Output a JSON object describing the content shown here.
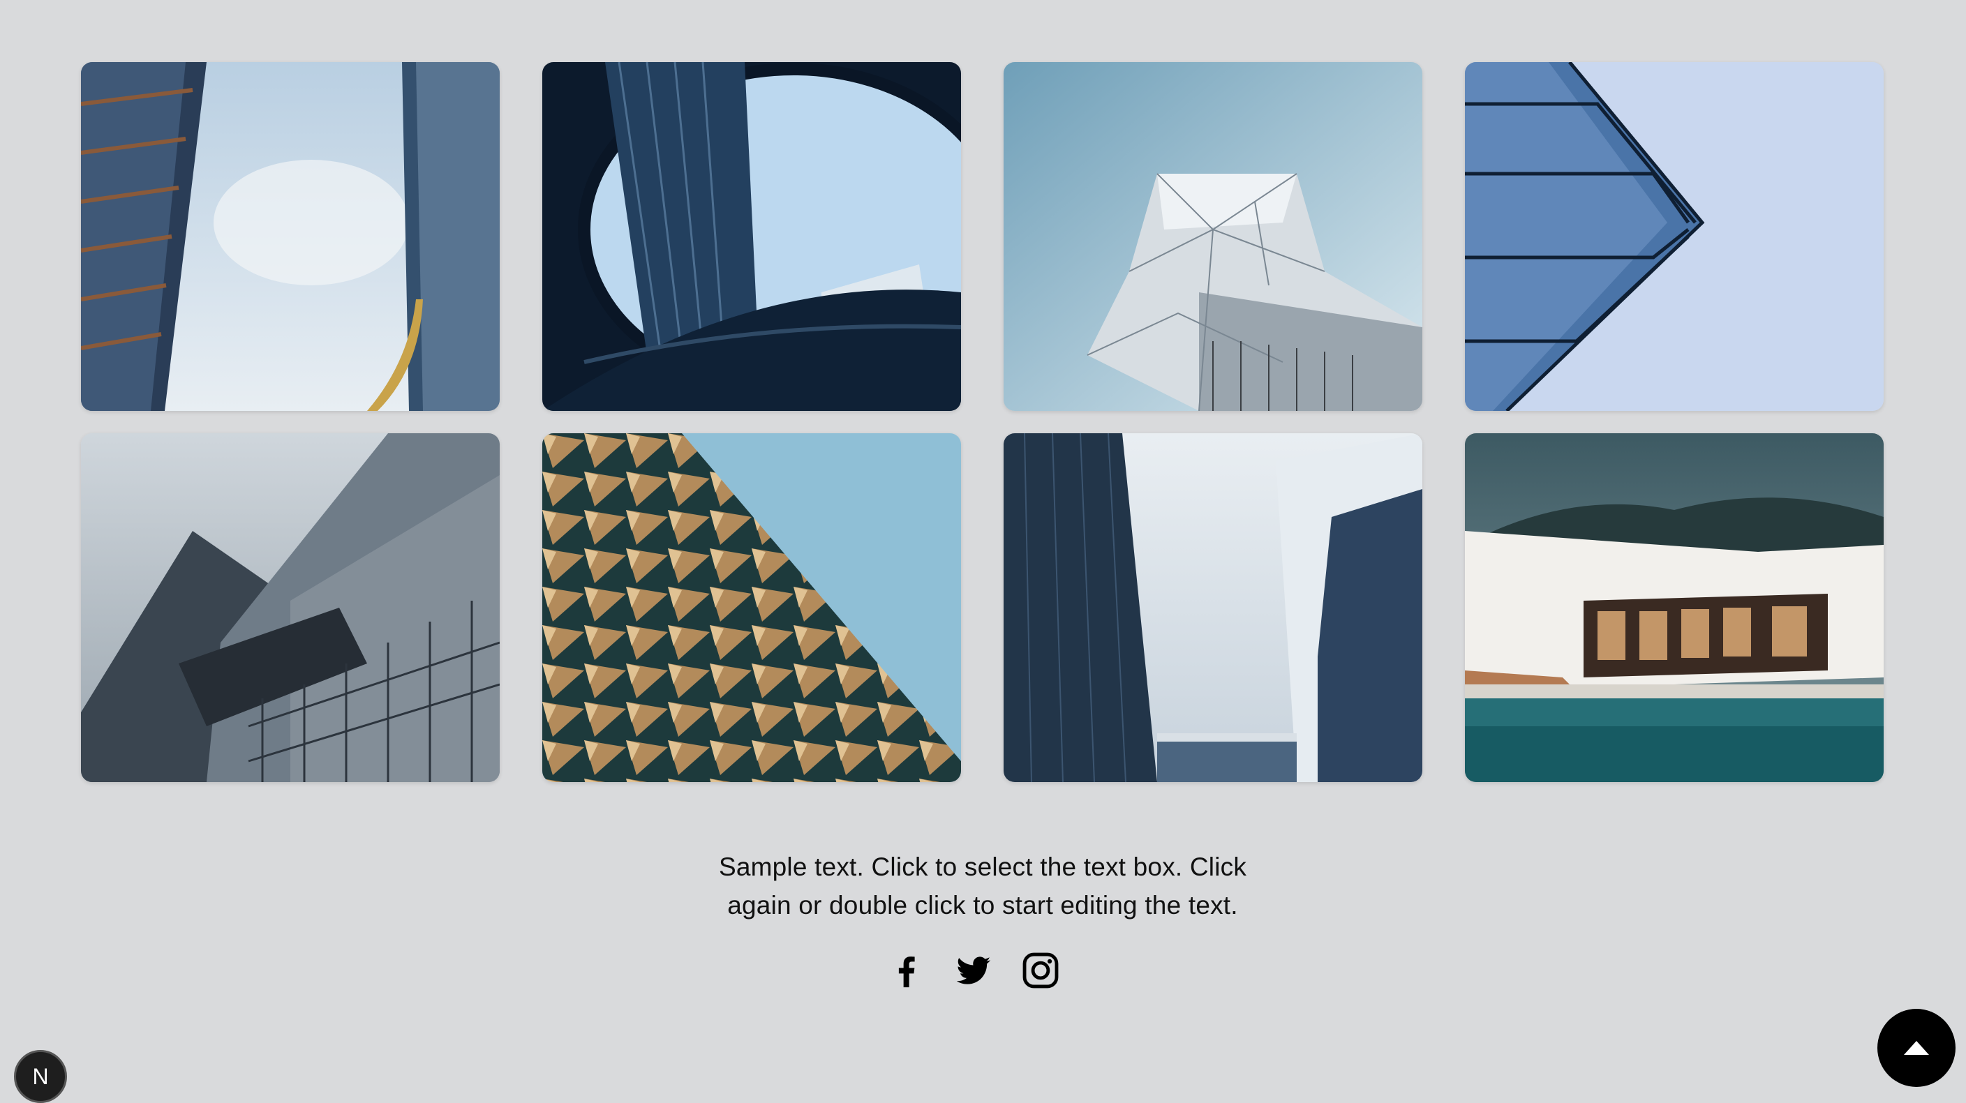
{
  "gallery": {
    "images": [
      {
        "alt": "Glass towers viewed from below",
        "icon": "building-photo"
      },
      {
        "alt": "Curved skyscraper through round opening",
        "icon": "building-photo"
      },
      {
        "alt": "Faceted white building",
        "icon": "building-photo"
      },
      {
        "alt": "Glass facade corner against sky",
        "icon": "building-photo"
      },
      {
        "alt": "Office towers under cloudy sky",
        "icon": "building-photo"
      },
      {
        "alt": "Triangular spiked facade",
        "icon": "building-photo"
      },
      {
        "alt": "Twin towers looking up",
        "icon": "building-photo"
      },
      {
        "alt": "Modern villa with pool",
        "icon": "building-photo"
      }
    ]
  },
  "text": {
    "line1": "Sample text. Click to select the text box. Click",
    "line2": "again or double click to start editing the text."
  },
  "socials": [
    {
      "name": "facebook",
      "icon": "facebook-icon"
    },
    {
      "name": "twitter",
      "icon": "twitter-icon"
    },
    {
      "name": "instagram",
      "icon": "instagram-icon"
    }
  ],
  "back_to_top": {
    "icon": "caret-up-icon"
  },
  "badge": {
    "label": "N"
  },
  "colors": {
    "background": "#d9dadc",
    "text": "#111111",
    "button": "#000000"
  }
}
